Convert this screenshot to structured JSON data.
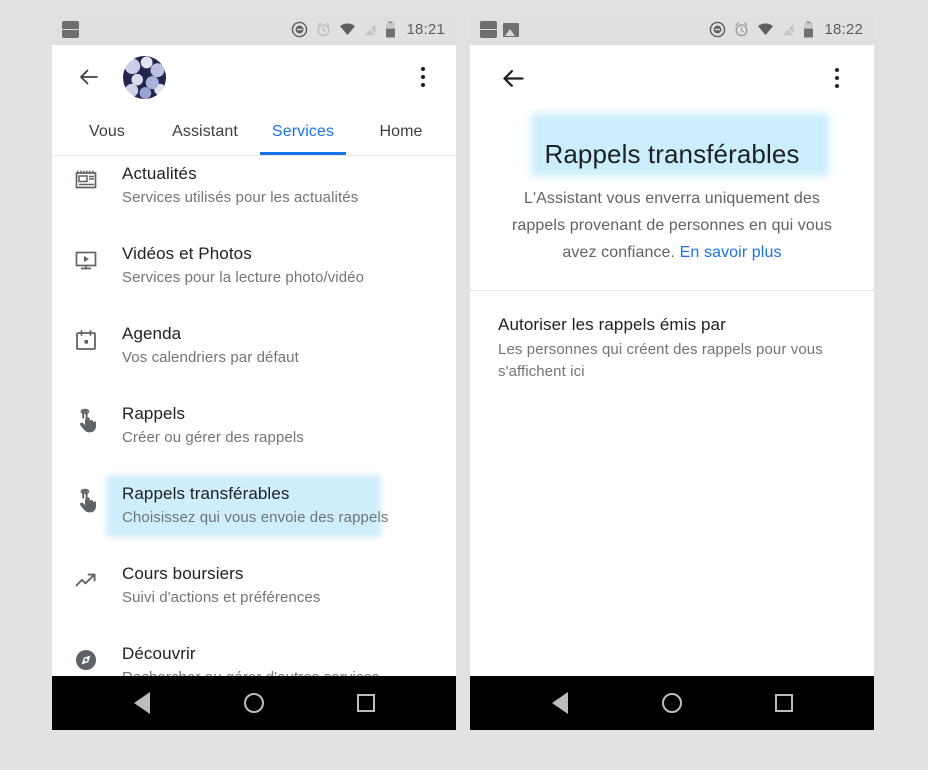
{
  "left_screen": {
    "statusbar": {
      "time": "18:21",
      "notification_icons": [
        "news-notification-icon"
      ],
      "system_icons": [
        "do-not-disturb-icon",
        "alarm-icon",
        "wifi-icon",
        "signal-off-icon",
        "battery-icon"
      ]
    },
    "appbar": {
      "back": "back-arrow-icon",
      "avatar": "user-avatar",
      "menu": "overflow-menu-icon"
    },
    "tabs": [
      {
        "label": "Vous",
        "active": false
      },
      {
        "label": "Assistant",
        "active": false
      },
      {
        "label": "Services",
        "active": true
      },
      {
        "label": "Home",
        "active": false
      }
    ],
    "list": [
      {
        "icon": "news-icon",
        "title": "Actualités",
        "subtitle": "Services utilisés pour les actualités",
        "highlighted": false
      },
      {
        "icon": "video-icon",
        "title": "Vidéos et Photos",
        "subtitle": "Services pour la lecture photo/vidéo",
        "highlighted": false
      },
      {
        "icon": "calendar-icon",
        "title": "Agenda",
        "subtitle": "Vos calendriers par défaut",
        "highlighted": false
      },
      {
        "icon": "reminder-hand-icon",
        "title": "Rappels",
        "subtitle": "Créer ou gérer des rappels",
        "highlighted": false
      },
      {
        "icon": "reminder-hand-icon",
        "title": "Rappels transférables",
        "subtitle": "Choisissez qui vous envoie des rappels",
        "highlighted": true
      },
      {
        "icon": "trending-up-icon",
        "title": "Cours boursiers",
        "subtitle": "Suivi d'actions et préférences",
        "highlighted": false
      },
      {
        "icon": "compass-icon",
        "title": "Découvrir",
        "subtitle": "Rechercher ou gérer d'autres services",
        "highlighted": false
      }
    ],
    "navbar": [
      "nav-back-icon",
      "nav-home-icon",
      "nav-recents-icon"
    ]
  },
  "right_screen": {
    "statusbar": {
      "time": "18:22",
      "notification_icons": [
        "news-notification-icon",
        "image-notification-icon"
      ],
      "system_icons": [
        "do-not-disturb-icon",
        "alarm-icon",
        "wifi-icon",
        "signal-off-icon",
        "battery-icon"
      ]
    },
    "appbar": {
      "back": "back-arrow-icon",
      "menu": "overflow-menu-icon"
    },
    "hero": {
      "title": "Rappels transférables",
      "description": "L'Assistant vous enverra uniquement des rappels provenant de personnes en qui vous avez confiance. ",
      "link": "En savoir plus"
    },
    "section": {
      "title": "Autoriser les rappels émis par",
      "subtitle": "Les personnes qui créent des rappels pour vous s'affichent ici"
    },
    "navbar": [
      "nav-back-icon",
      "nav-home-icon",
      "nav-recents-icon"
    ]
  },
  "colors": {
    "accent": "#1a73e8",
    "highlight": "#cfeefb",
    "page_background": "#e2e2e2",
    "statusbar_background": "#e0e0e0",
    "navbar_background": "#000000"
  }
}
